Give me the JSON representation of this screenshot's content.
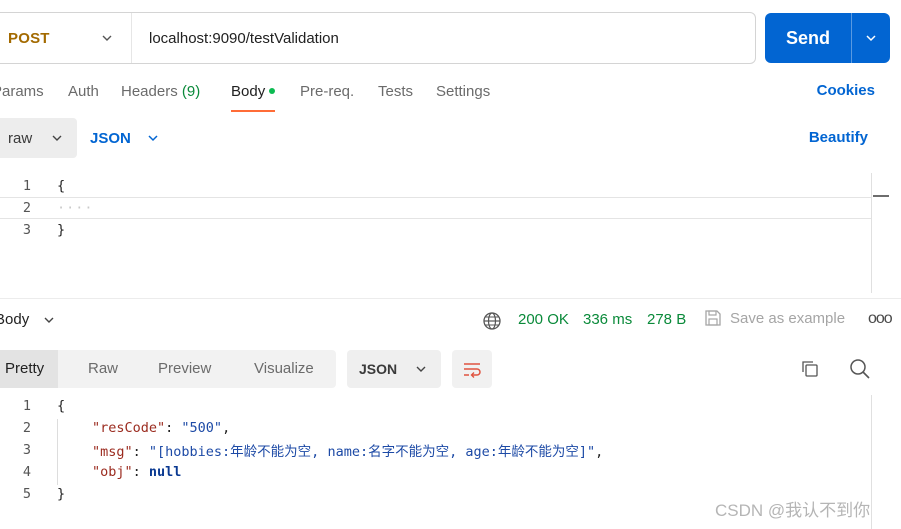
{
  "request": {
    "method": "POST",
    "url": "localhost:9090/testValidation",
    "send_label": "Send"
  },
  "tabs": [
    {
      "label": "Params"
    },
    {
      "label": "Auth"
    },
    {
      "label": "Headers",
      "count": "(9)"
    },
    {
      "label": "Body"
    },
    {
      "label": "Pre-req."
    },
    {
      "label": "Tests"
    },
    {
      "label": "Settings"
    }
  ],
  "active_tab": "Body",
  "cookies_label": "Cookies",
  "body_type": "raw",
  "body_format": "JSON",
  "beautify_label": "Beautify",
  "request_body": {
    "line_numbers": [
      "1",
      "2",
      "3"
    ],
    "lines": [
      "{",
      "····",
      "}"
    ]
  },
  "response": {
    "section_label": "Body",
    "status": "200 OK",
    "time": "336 ms",
    "size": "278 B",
    "save_label": "Save as example",
    "more_label": "ooo",
    "view_tabs": [
      "Pretty",
      "Raw",
      "Preview",
      "Visualize"
    ],
    "active_view": "Pretty",
    "format": "JSON",
    "line_numbers": [
      "1",
      "2",
      "3",
      "4",
      "5"
    ],
    "open_brace": "{",
    "close_brace": "}",
    "fields": [
      {
        "key": "\"resCode\"",
        "value": "\"500\"",
        "trail": ","
      },
      {
        "key": "\"msg\"",
        "value": "\"[hobbies:年龄不能为空, name:名字不能为空, age:年龄不能为空]\"",
        "trail": ","
      },
      {
        "key": "\"obj\"",
        "value": "null",
        "trail": ""
      }
    ]
  },
  "watermark": "CSDN @我认不到你"
}
